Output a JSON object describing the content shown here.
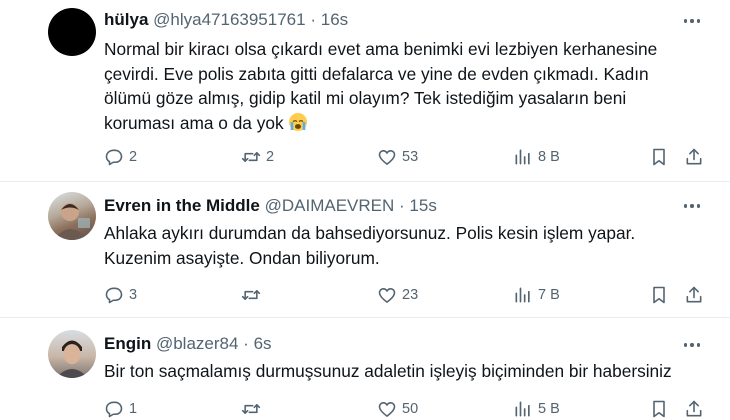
{
  "replies": [
    {
      "name": "hülya",
      "handle": "@hlya47163951761",
      "sep": "·",
      "time": "16s",
      "lines": [
        "Normal bir kiracı olsa çıkardı evet ama benimki evi lezbiyen kerhanesine",
        "çevirdi. Eve polis zabıta gitti defalarca ve yine de evden çıkmadı. Kadın",
        "ölümü göze almış, gidip katil mi olayım? Tek istediğim yasaların beni",
        "koruması ama o da yok"
      ],
      "emoji": "crying-face-emoji",
      "replies_count": "2",
      "retweets_count": "2",
      "likes_count": "53",
      "views_count": "8 B",
      "avatar": "black-circle-avatar"
    },
    {
      "name": "Evren in the Middle",
      "handle": "@DAIMAEVREN",
      "sep": "·",
      "time": "15s",
      "lines": [
        "Ahlaka aykırı durumdan da bahsediyorsunuz. Polis kesin işlem yapar.",
        "Kuzenim asayişte. Ondan biliyorum."
      ],
      "replies_count": "3",
      "retweets_count": "",
      "likes_count": "23",
      "views_count": "7 B",
      "avatar": "photo-avatar"
    },
    {
      "name": "Engin",
      "handle": "@blazer84",
      "sep": "·",
      "time": "6s",
      "lines": [
        "Bir ton saçmalamış durmuşsunuz adaletin işleyiş biçiminden bir habersiniz"
      ],
      "replies_count": "1",
      "retweets_count": "",
      "likes_count": "50",
      "views_count": "5 B",
      "avatar": "photo-avatar"
    }
  ],
  "colors": {
    "text": "#0f1419",
    "secondary": "#536471",
    "divider": "#e6ecf0"
  }
}
